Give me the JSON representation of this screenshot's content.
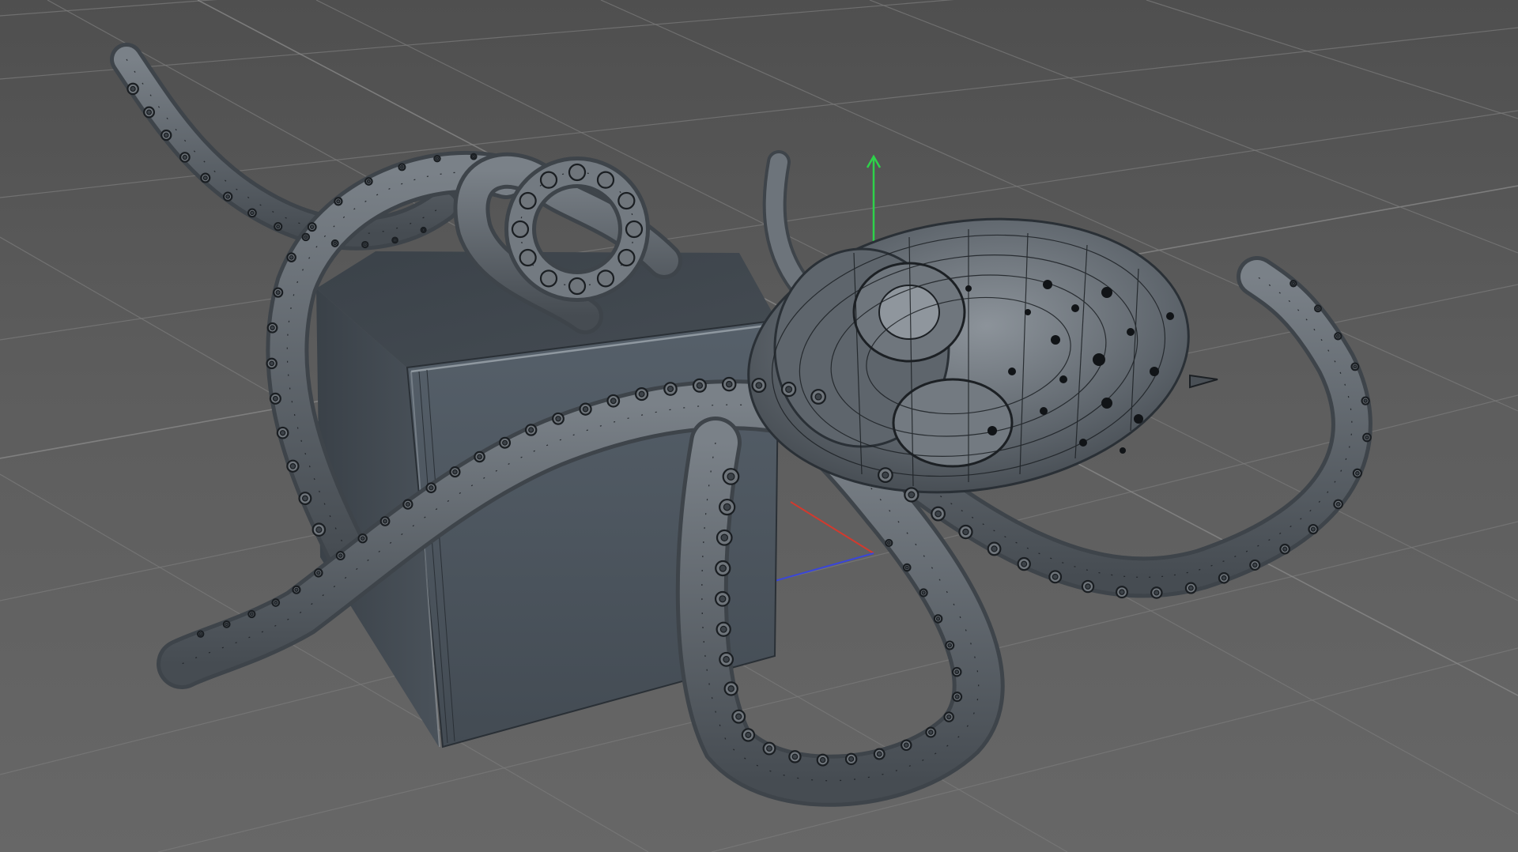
{
  "viewport": {
    "background_color": "#5c5c5c",
    "grid_color": "#8a8a8a",
    "scene_objects": [
      "octopus-mesh",
      "cube-mesh"
    ],
    "mesh_color": "#5e656c",
    "wireframe_color": "#1c2024",
    "axis_colors": {
      "x": "#d23a2e",
      "y": "#2ed24a",
      "z": "#3a46d8"
    },
    "icons": [
      "axis-gizmo-icon",
      "y-axis-arrow-icon"
    ]
  }
}
